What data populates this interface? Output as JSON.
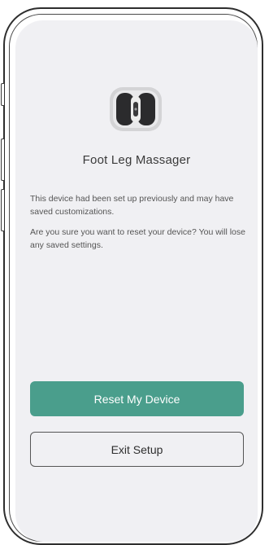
{
  "device": {
    "icon": "foot-massager-icon",
    "name": "Foot Leg Massager"
  },
  "messages": [
    "This device had been set up previously and may have saved customizations.",
    "Are you sure you want to reset your device? You will lose any saved settings."
  ],
  "actions": {
    "reset_label": "Reset My Device",
    "exit_label": "Exit Setup"
  },
  "colors": {
    "accent": "#4a9e8c",
    "screen_background": "#f0f0f3"
  }
}
